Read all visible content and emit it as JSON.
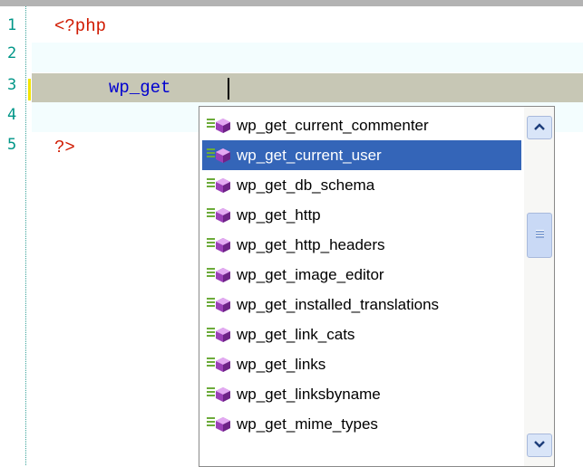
{
  "editor": {
    "line_numbers": [
      "1",
      "2",
      "3",
      "4",
      "5"
    ],
    "lines": [
      "<?php",
      "",
      "wp_get",
      "",
      "?>"
    ]
  },
  "autocomplete": {
    "selected_index": 1,
    "items": [
      {
        "label": "wp_get_current_commenter",
        "icon": "method-gem-icon"
      },
      {
        "label": "wp_get_current_user",
        "icon": "method-gem-icon"
      },
      {
        "label": "wp_get_db_schema",
        "icon": "method-gem-icon"
      },
      {
        "label": "wp_get_http",
        "icon": "method-gem-icon"
      },
      {
        "label": "wp_get_http_headers",
        "icon": "method-gem-icon"
      },
      {
        "label": "wp_get_image_editor",
        "icon": "method-gem-icon"
      },
      {
        "label": "wp_get_installed_translations",
        "icon": "method-gem-icon"
      },
      {
        "label": "wp_get_link_cats",
        "icon": "method-gem-icon"
      },
      {
        "label": "wp_get_links",
        "icon": "method-gem-icon"
      },
      {
        "label": "wp_get_linksbyname",
        "icon": "method-gem-icon"
      },
      {
        "label": "wp_get_mime_types",
        "icon": "method-gem-icon"
      }
    ]
  },
  "colors": {
    "php_tag": "#d01a00",
    "code_text": "#0000d0",
    "line_number": "#009688",
    "selection": "#3465b8"
  }
}
